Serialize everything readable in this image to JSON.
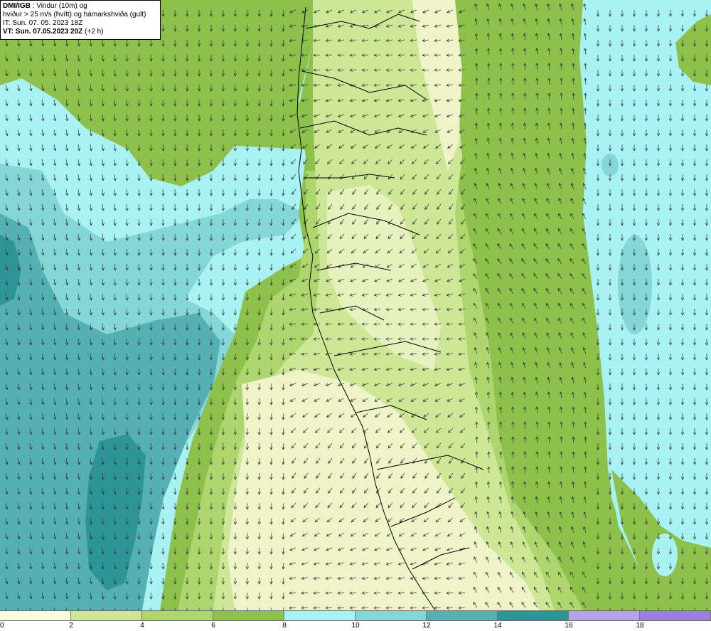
{
  "header": {
    "source": "DMI/IGB",
    "desc1": " : Vindur (10m) og",
    "desc2": "hviður > 25 m/s (hvítt) og hámarkshviða (gult)",
    "issue": "IT: Sun. 07. 05. 2023 18Z",
    "valid": "VT: Sun. 07.05.2023 20Z",
    "valid_suffix": " (+2 h)"
  },
  "legend": {
    "ticks": [
      "0",
      "2",
      "4",
      "6",
      "8",
      "10",
      "12",
      "14",
      "16",
      "18"
    ],
    "colors": [
      "#fafae0",
      "#cde796",
      "#aed66e",
      "#8dc14b",
      "#a8f2f4",
      "#85d6d6",
      "#55b0b4",
      "#2e9596",
      "#b4a3ec",
      "#9a7fdf"
    ]
  },
  "map": {
    "icon": "wind-arrow-icon",
    "colors": {
      "land_light": "#eef4c8",
      "land_mid": "#cde796",
      "land_dark": "#aed66e",
      "sea_green": "#8dc14b",
      "sea_cyan": "#a8f2f4",
      "sea_teal": "#85d6d6",
      "sea_deep": "#55b0b4",
      "sea_darkest": "#2e9596",
      "coast": "#000000"
    }
  }
}
